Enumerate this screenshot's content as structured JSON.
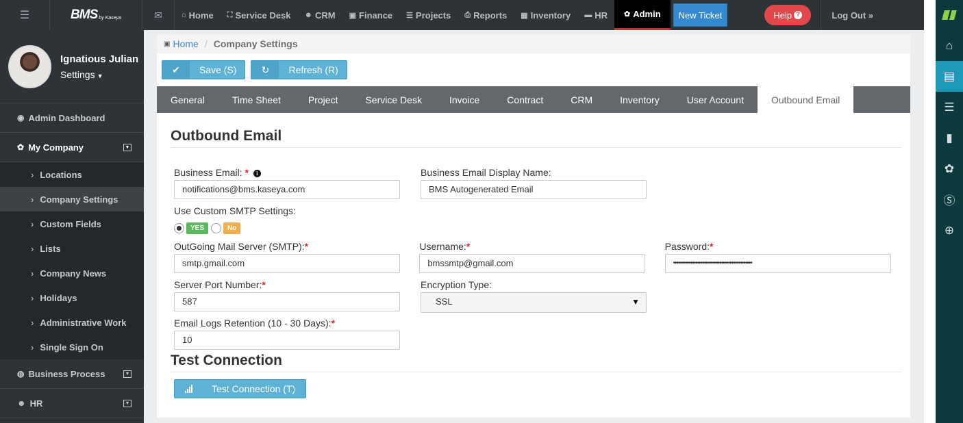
{
  "topbar": {
    "logo": "BMS",
    "logo_sub": "by Kaseya",
    "nav": [
      {
        "label": "Home",
        "icon": "home-icon",
        "glyph": "⌂"
      },
      {
        "label": "Service Desk",
        "icon": "sitemap-icon",
        "glyph": "⛶"
      },
      {
        "label": "CRM",
        "icon": "users-icon",
        "glyph": "👥"
      },
      {
        "label": "Finance",
        "icon": "money-icon",
        "glyph": "▣"
      },
      {
        "label": "Projects",
        "icon": "list-icon",
        "glyph": "☰"
      },
      {
        "label": "Reports",
        "icon": "print-icon",
        "glyph": "⎙"
      },
      {
        "label": "Inventory",
        "icon": "building-icon",
        "glyph": "▦"
      },
      {
        "label": "HR",
        "icon": "briefcase-icon",
        "glyph": "▬"
      },
      {
        "label": "Admin",
        "icon": "gear-icon",
        "glyph": "✿"
      }
    ],
    "new_ticket": "New Ticket",
    "help": "Help",
    "logout": "Log Out »"
  },
  "profile": {
    "name": "Ignatious Julian",
    "role": "Settings"
  },
  "sidebar": {
    "admin_dashboard": "Admin Dashboard",
    "my_company": "My Company",
    "sub_items": [
      "Locations",
      "Company Settings",
      "Custom Fields",
      "Lists",
      "Company News",
      "Holidays",
      "Administrative Work",
      "Single Sign On"
    ],
    "business_process": "Business Process",
    "hr": "HR"
  },
  "breadcrumb": {
    "home": "Home",
    "separator": "/",
    "current": "Company Settings"
  },
  "toolbar": {
    "save": "Save (S)",
    "refresh": "Refresh (R)"
  },
  "tabs": [
    "General",
    "Time Sheet",
    "Project",
    "Service Desk",
    "Invoice",
    "Contract",
    "CRM",
    "Inventory",
    "User Account",
    "Outbound Email"
  ],
  "outbound": {
    "title": "Outbound Email",
    "business_email_label": "Business Email:",
    "business_email": "notifications@bms.kaseya.com",
    "display_name_label": "Business Email Display Name:",
    "display_name": "BMS Autogenerated Email",
    "custom_smtp_label": "Use Custom SMTP Settings:",
    "yes": "YES",
    "no": "No",
    "smtp_label": "OutGoing Mail Server (SMTP):",
    "smtp": "smtp.gmail.com",
    "username_label": "Username:",
    "username": "bmssmtp@gmail.com",
    "password_label": "Password:",
    "password": "••••••••••••••••••••••••••••••••••••••••••••••",
    "port_label": "Server Port Number:",
    "port": "587",
    "encryption_label": "Encryption Type:",
    "encryption": "SSL",
    "retention_label": "Email Logs Retention (10 - 30 Days):",
    "retention": "10",
    "required_mark": "*"
  },
  "test": {
    "title": "Test Connection",
    "button": "Test Connection (T)"
  }
}
